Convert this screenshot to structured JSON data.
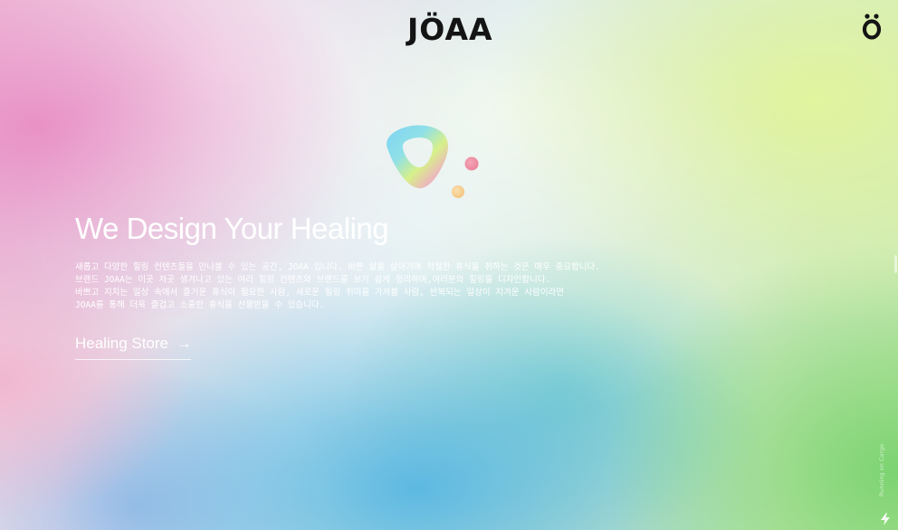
{
  "header": {
    "logo_text": "JÖAA",
    "menu_icon": "joaa-face-icon"
  },
  "hero": {
    "graphic_icon": "gradient-blob-icon",
    "headline": "We Design Your Healing",
    "description_lines": [
      "새롭고 다양한 힐링 컨텐츠들을 만나볼 수 있는 공간, JOAA 입니다. 바쁜 삶을 살아가며 적절한 휴식을 취하는 것은 매우 중요합니다.",
      "브랜드 JOAA는 이곳 저곳 생겨나고 있는 여러 힐링 컨텐츠와 브랜드를 보기 쉽게 정리하며,여러분의 힐링을 디자인합니다.",
      "바쁘고 지치는 일상 속에서  즐거운 휴식이 필요한 사람, 새로운 힐링 취미를 가져볼 사람, 반복되는 일상이 지겨운 사람이라면",
      "JOAA를 통해 더욱 즐겁고 소중한 휴식을 선물받을 수 있습니다."
    ],
    "cta_label": "Healing Store",
    "cta_arrow": "→"
  },
  "footer": {
    "running_on": "Running on Cargo",
    "bolt_icon": "bolt-icon"
  },
  "colors": {
    "logo": "#141414",
    "text": "#ffffff",
    "pink": "#e88ec4",
    "blue": "#56b6e2",
    "green": "#78d26e",
    "yellow_green": "#e2f49a"
  }
}
